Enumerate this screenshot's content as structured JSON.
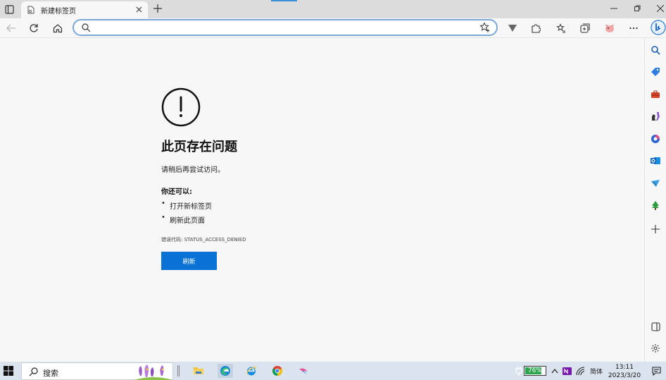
{
  "browser": {
    "tab": {
      "title": "新建标签页"
    },
    "address": {
      "value": "",
      "placeholder": ""
    }
  },
  "error_page": {
    "title": "此页存在问题",
    "subtitle": "请稍后再尝试访问。",
    "you_can_label": "你还可以:",
    "options": [
      "打开新标签页",
      "刷新此页面"
    ],
    "error_code": "错误代码: STATUS_ACCESS_DENIED",
    "refresh_button": "刷新"
  },
  "sidebar": {
    "icons": [
      "search-icon",
      "tag-icon",
      "toolbox-icon",
      "games-icon",
      "office-icon",
      "outlook-icon",
      "send-icon",
      "tree-icon",
      "add-icon",
      "split-screen-icon",
      "settings-icon"
    ]
  },
  "taskbar": {
    "search_label": "搜索",
    "apps": [
      "file-explorer",
      "edge",
      "ie",
      "chrome",
      "app"
    ],
    "battery_percent": "76%",
    "ime": "简体",
    "time": "13:11",
    "date": "2023/3/20"
  },
  "colors": {
    "accent": "#0a72d4",
    "battery": "#2da44e",
    "taskbar": "#dbe3ee"
  }
}
